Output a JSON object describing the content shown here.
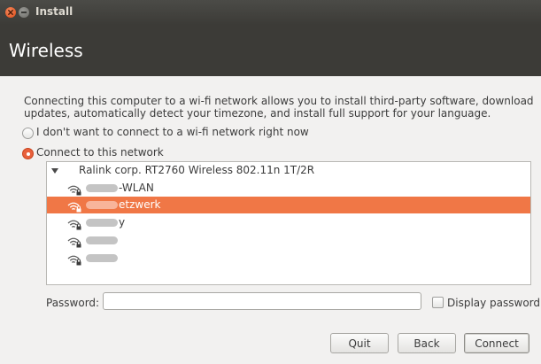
{
  "window": {
    "title": "Install"
  },
  "header": {
    "title": "Wireless"
  },
  "description": "Connecting this computer to a wi-fi network allows you to install third-party software, download updates, automatically detect your timezone, and install full support for your language.",
  "options": {
    "no_connect": {
      "label": "I don't want to connect to a wi-fi network right now",
      "selected": false
    },
    "connect": {
      "label": "Connect to this network",
      "selected": true
    }
  },
  "network_list": {
    "device": "Ralink corp. RT2760 Wireless 802.11n 1T/2R",
    "networks": [
      {
        "suffix": "-WLAN",
        "selected": false
      },
      {
        "suffix": "etzwerk",
        "selected": true
      },
      {
        "suffix": "y",
        "selected": false
      },
      {
        "suffix": "",
        "selected": false
      },
      {
        "suffix": "",
        "selected": false
      }
    ]
  },
  "password": {
    "label": "Password:",
    "value": "",
    "placeholder": ""
  },
  "display_password": {
    "label": "Display password",
    "checked": false
  },
  "buttons": {
    "quit": "Quit",
    "back": "Back",
    "connect": "Connect"
  },
  "colors": {
    "accent": "#f07746",
    "titlebar": "#3c3b37",
    "close": "#df4a16"
  },
  "icons": {
    "close": "close-icon",
    "minimize": "minimize-icon",
    "wifi": "wifi-lock-icon",
    "expander": "expander-arrow-icon"
  }
}
